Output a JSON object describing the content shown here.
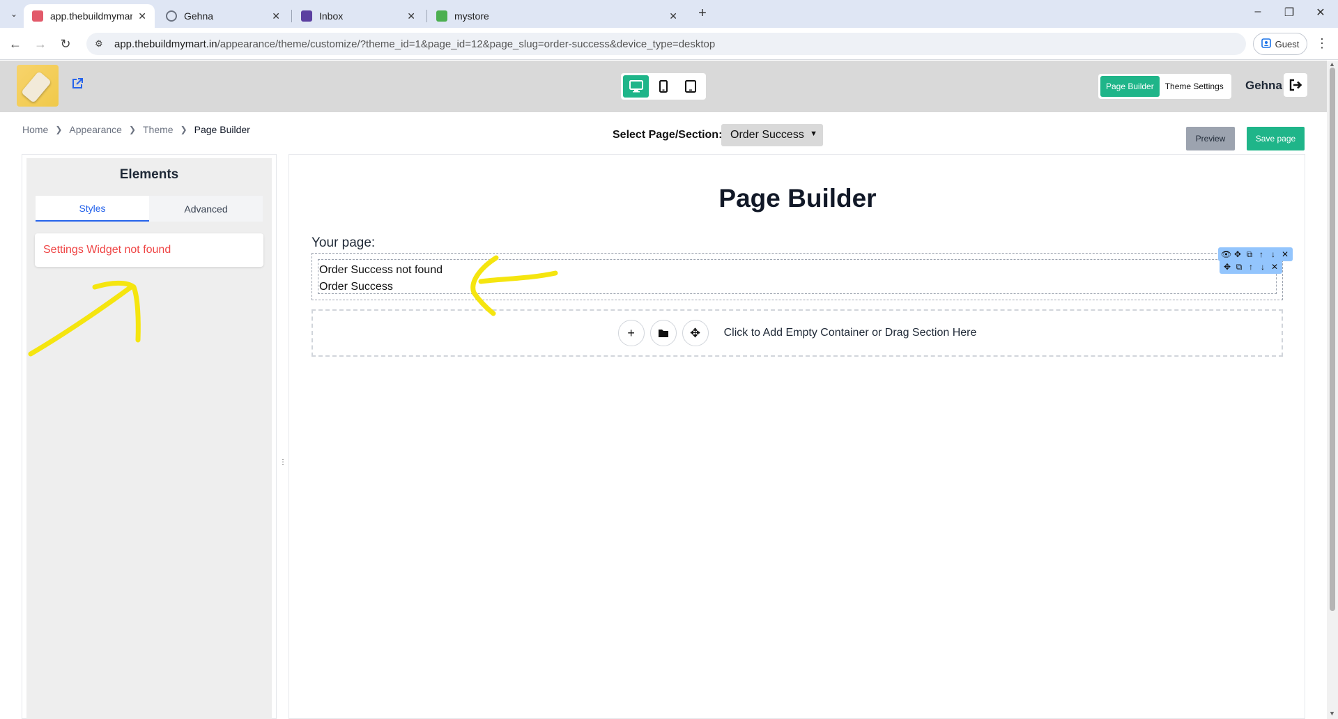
{
  "browser": {
    "tabs": [
      {
        "label": "app.thebuildmymart.in/appeara",
        "active": true,
        "favicon_color": "#e25a6a"
      },
      {
        "label": "Gehna",
        "active": false,
        "favicon_color": "#6b7280"
      },
      {
        "label": "Inbox",
        "active": false,
        "favicon_color": "#5b3fa0"
      },
      {
        "label": "mystore",
        "active": false,
        "favicon_color": "#4caf50"
      }
    ],
    "url_host": "app.thebuildmymart.in",
    "url_path": "/appearance/theme/customize/?theme_id=1&page_id=12&page_slug=order-success&device_type=desktop",
    "profile_label": "Guest"
  },
  "header": {
    "device_modes": [
      "desktop-icon",
      "mobile-icon",
      "tablet-icon"
    ],
    "active_device": "desktop",
    "mode_buttons": {
      "page_builder": "Page Builder",
      "theme_settings": "Theme Settings"
    },
    "user_name": "Gehna",
    "accent_color": "#1fb589"
  },
  "breadcrumb": [
    "Home",
    "Appearance",
    "Theme",
    "Page Builder"
  ],
  "toolbar": {
    "select_label": "Select Page/Section:",
    "selected_page": "Order Success",
    "preview_label": "Preview",
    "save_label": "Save page"
  },
  "sidebar": {
    "title": "Elements",
    "tabs": [
      "Styles",
      "Advanced"
    ],
    "active_tab": "Styles",
    "message": "Settings Widget not found"
  },
  "canvas": {
    "title": "Page Builder",
    "your_page_label": "Your page:",
    "section_lines": [
      "Order Success not found",
      "Order Success"
    ],
    "add_zone_label": "Click to Add Empty Container or Drag Section Here"
  }
}
